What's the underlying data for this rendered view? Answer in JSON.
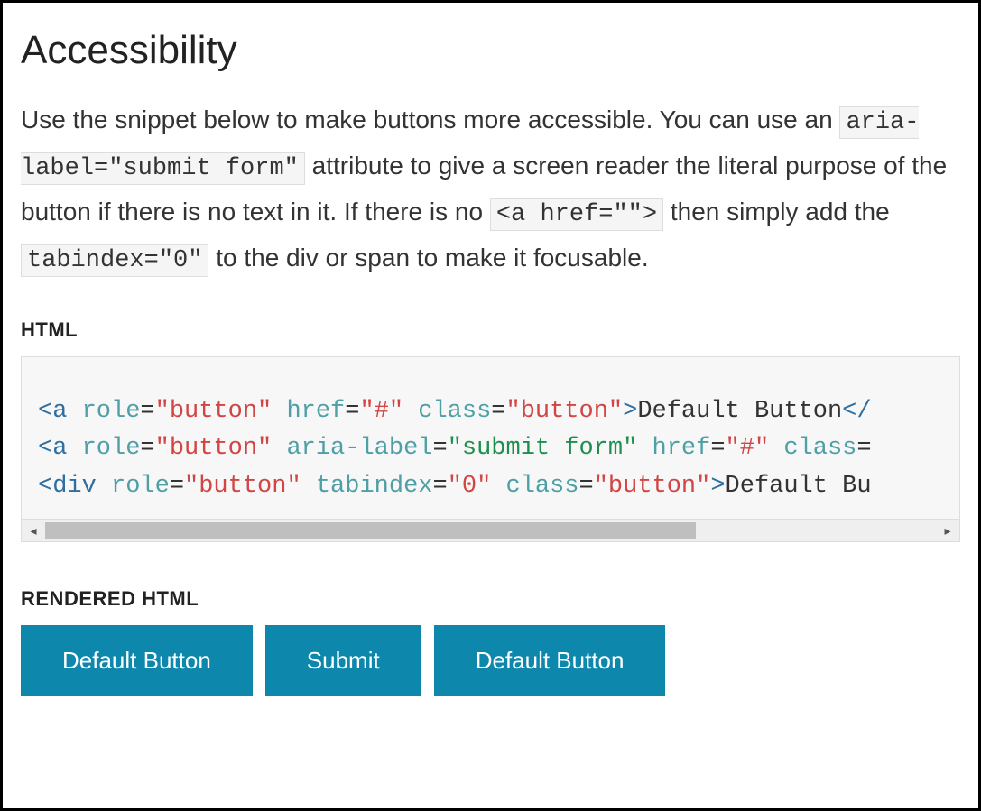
{
  "heading": "Accessibility",
  "intro": {
    "t1": "Use the snippet below to make buttons more accessible. You can use an ",
    "code1": "aria-label=\"submit form\"",
    "t2": " attribute to give a screen reader the literal purpose of the button if there is no text in it. If there is no ",
    "code2": "<a href=\"\">",
    "t3": " then simply add the ",
    "code3": "tabindex=\"0\"",
    "t4": " to the div or span to make it focusable."
  },
  "labels": {
    "html": "HTML",
    "rendered": "RENDERED HTML"
  },
  "code": {
    "l1": {
      "tag_open": "<a",
      "a1": "role",
      "v1": "\"button\"",
      "a2": "href",
      "v2": "\"#\"",
      "a3": "class",
      "v3": "\"button\"",
      "close": ">",
      "text": "Default Button",
      "end": "</"
    },
    "l2": {
      "tag_open": "<a",
      "a1": "role",
      "v1": "\"button\"",
      "a2": "aria-label",
      "v2": "\"submit form\"",
      "a3": "href",
      "v3": "\"#\"",
      "a4": "class",
      "eq": "="
    },
    "l3": {
      "tag_open": "<div",
      "a1": "role",
      "v1": "\"button\"",
      "a2": "tabindex",
      "v2": "\"0\"",
      "a3": "class",
      "v3": "\"button\"",
      "close": ">",
      "text": "Default Bu"
    }
  },
  "scroll": {
    "left_arrow": "◂",
    "right_arrow": "▸"
  },
  "buttons": {
    "b1": "Default Button",
    "b2": "Submit",
    "b3": "Default Button"
  }
}
